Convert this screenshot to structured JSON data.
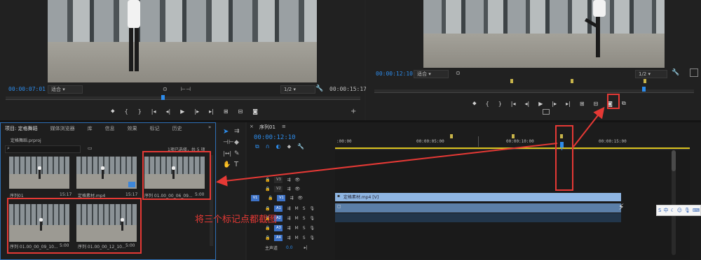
{
  "source_monitor": {
    "timecode_current": "00:00:07:01",
    "fit_label": "适合",
    "resolution": "1/2",
    "timecode_duration": "00:00:15:17"
  },
  "program_monitor": {
    "timecode_current": "00:00:12:10",
    "fit_label": "适合",
    "resolution": "1/2"
  },
  "project_panel": {
    "tabs": [
      "项目: 定格舞蹈",
      "媒体浏览器",
      "库",
      "信息",
      "效果",
      "标记",
      "历史"
    ],
    "file_name": "定格舞蹈.prproj",
    "selection_info": "1项已选择，共 5 项",
    "items": [
      {
        "name": "序列01",
        "duration": "15:17"
      },
      {
        "name": "定格素材.mp4",
        "duration": "15:17"
      },
      {
        "name": "序列 01.00_00_06_09...",
        "duration": "5:00"
      },
      {
        "name": "序列 01.00_00_09_10...",
        "duration": "5:00"
      },
      {
        "name": "序列 01.00_00_12_10...",
        "duration": "5:00"
      }
    ]
  },
  "timeline": {
    "tab_label": "序列01",
    "timecode": "00:00:12:10",
    "ruler_labels": [
      ":00:00",
      "00:00:05:00",
      "00:00:10:00",
      "00:00:15:00"
    ],
    "video_tracks": [
      "V3",
      "V2",
      "V1"
    ],
    "source_patch": "V1",
    "audio_tracks": [
      "A1",
      "A2",
      "A3",
      "A4"
    ],
    "master_label": "主声道",
    "master_value": "0.0",
    "video_clip_label": "定格素材.mp4 [V]"
  },
  "annotation": {
    "text": "将三个标记点都截图",
    "color": "#e53935"
  },
  "colors": {
    "accent_blue": "#2d8ceb",
    "clip_video": "#8fb6e3",
    "clip_audio": "#5b7fa8",
    "work_area": "#d9c11d",
    "marker": "#c8b44a"
  }
}
